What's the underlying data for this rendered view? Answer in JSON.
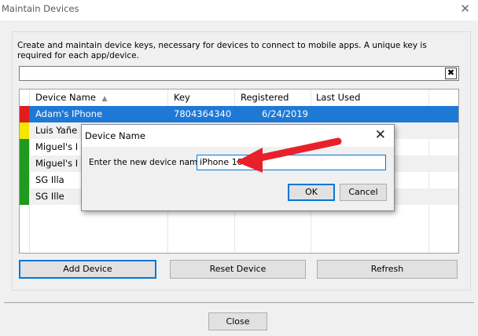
{
  "window": {
    "title": "Maintain Devices",
    "close_glyph": "✕"
  },
  "description": "Create and maintain device keys, necessary for devices to connect to mobile apps.  A unique key is required for each app/device.",
  "search": {
    "value": "",
    "clear_glyph": "✖"
  },
  "table": {
    "columns": [
      "Device Name",
      "Key",
      "Registered",
      "Last Used"
    ],
    "sort_glyph": "▲",
    "rows": [
      {
        "name": "Adam's IPhone",
        "key": "7804364340",
        "registered": "6/24/2019",
        "last_used": "",
        "status_color": "#e01e1e",
        "selected": true
      },
      {
        "name": "Luis Yañe",
        "key": "",
        "registered": "",
        "last_used": "",
        "status_color": "#f5e600",
        "selected": false
      },
      {
        "name": "Miguel's I",
        "key": "",
        "registered": "",
        "last_used": "",
        "status_color": "#1f9a1f",
        "selected": false
      },
      {
        "name": "Miguel's I",
        "key": "",
        "registered": "",
        "last_used": "",
        "status_color": "#1f9a1f",
        "selected": false
      },
      {
        "name": "SG Illa",
        "key": "",
        "registered": "",
        "last_used": "",
        "status_color": "#1f9a1f",
        "selected": false
      },
      {
        "name": "SG Ille",
        "key": "",
        "registered": "",
        "last_used": "",
        "status_color": "#1f9a1f",
        "selected": false
      }
    ]
  },
  "buttons": {
    "add": "Add Device",
    "reset": "Reset Device",
    "refresh": "Refresh",
    "close": "Close"
  },
  "dialog": {
    "title": "Device Name",
    "close_glyph": "✕",
    "label": "Enter the new device name",
    "input_value": "iPhone 10",
    "ok": "OK",
    "cancel": "Cancel"
  },
  "colors": {
    "selection": "#1e78d6",
    "arrow": "#e8202a",
    "focus": "#0078d7"
  }
}
